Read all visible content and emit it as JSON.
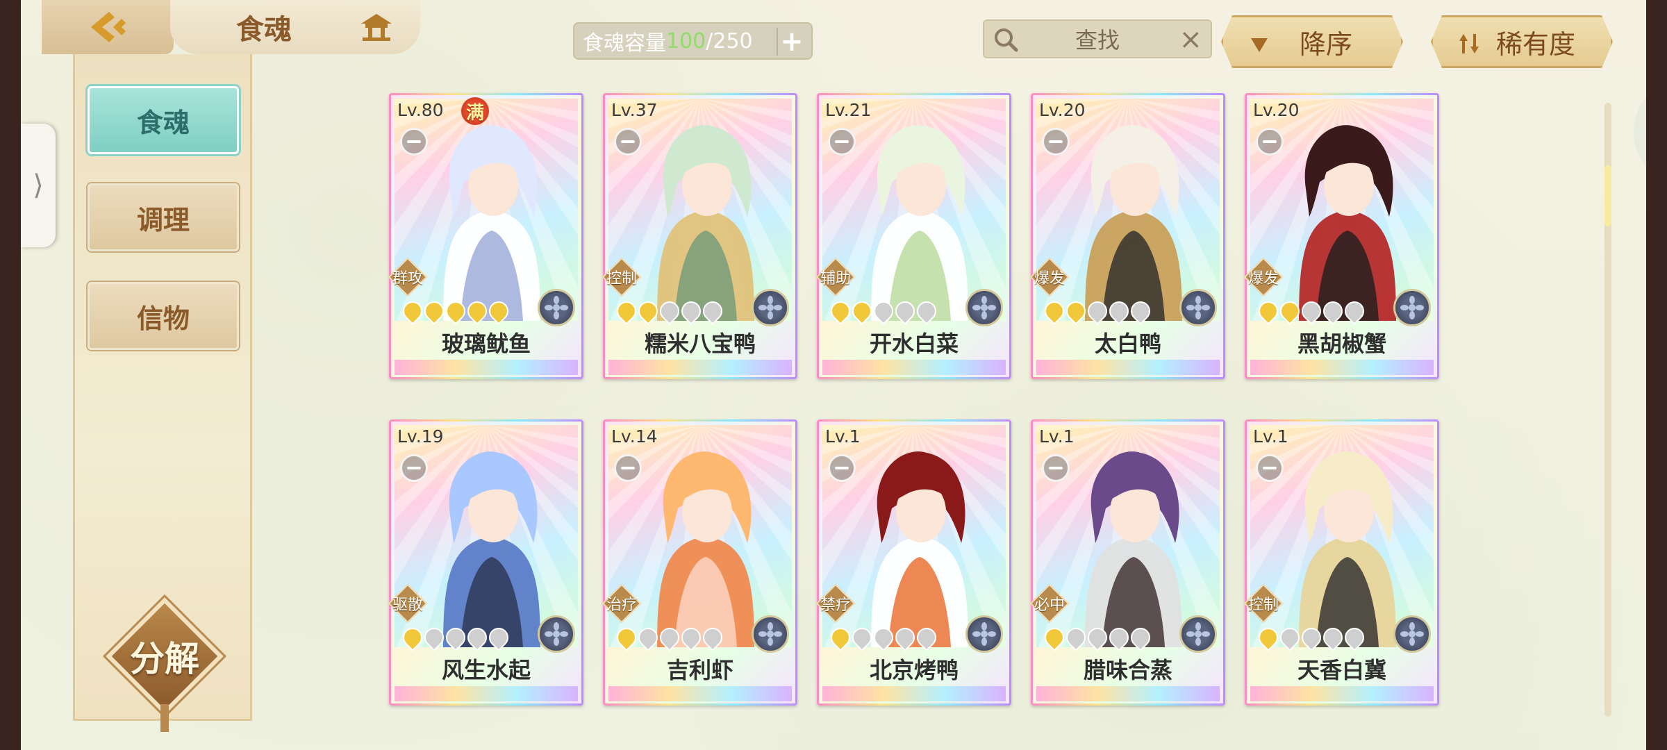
{
  "header": {
    "title": "食魂",
    "capacity_label": "食魂容量 ",
    "capacity_used": "100",
    "capacity_total": "/250",
    "add_label": "+",
    "search_label": "查找",
    "search_clear": "×",
    "sort_order_label": "降序",
    "sort_rarity_label": "稀有度"
  },
  "sidebar": {
    "items": [
      {
        "label": "食魂",
        "active": true
      },
      {
        "label": "调理",
        "active": false
      },
      {
        "label": "信物",
        "active": false
      }
    ],
    "decompose_label": "分解"
  },
  "pull_tab": "⟩",
  "cards": [
    {
      "level": "Lv.80",
      "full": "满",
      "role": "群攻",
      "stars": 5,
      "name": "玻璃鱿鱼",
      "palette": [
        "#dfe8ff",
        "#9aa8d8",
        "#ffffff"
      ]
    },
    {
      "level": "Lv.37",
      "role": "控制",
      "stars": 2,
      "name": "糯米八宝鸭",
      "palette": [
        "#cfe8d0",
        "#6f9a7a",
        "#e0c27a"
      ]
    },
    {
      "level": "Lv.21",
      "role": "辅助",
      "stars": 2,
      "name": "开水白菜",
      "palette": [
        "#eaf5e0",
        "#b5d99a",
        "#ffffff"
      ]
    },
    {
      "level": "Lv.20",
      "role": "爆发",
      "stars": 2,
      "name": "太白鸭",
      "palette": [
        "#f5f0e6",
        "#2b2b2b",
        "#c9a05a"
      ]
    },
    {
      "level": "Lv.20",
      "role": "爆发",
      "stars": 2,
      "name": "黑胡椒蟹",
      "palette": [
        "#3a1a1a",
        "#1e1e1e",
        "#b52a2a"
      ]
    },
    {
      "level": "Lv.19",
      "role": "驱散",
      "stars": 1,
      "name": "风生水起",
      "palette": [
        "#a8c8ff",
        "#2c3550",
        "#5c7cc8"
      ]
    },
    {
      "level": "Lv.14",
      "role": "治疗",
      "stars": 1,
      "name": "吉利虾",
      "palette": [
        "#ffb870",
        "#ffd8c8",
        "#f08a50"
      ]
    },
    {
      "level": "Lv.1",
      "role": "禁疗",
      "stars": 1,
      "name": "北京烤鸭",
      "palette": [
        "#8a1a1a",
        "#e86a2a",
        "#ffffff"
      ]
    },
    {
      "level": "Lv.1",
      "role": "必中",
      "stars": 1,
      "name": "腊味合蒸",
      "palette": [
        "#6a4a8a",
        "#3a2a2a",
        "#e0e0e0"
      ]
    },
    {
      "level": "Lv.1",
      "role": "控制",
      "stars": 1,
      "name": "天香白冀",
      "palette": [
        "#f6ecc8",
        "#2a2a2a",
        "#e8d49a"
      ]
    }
  ],
  "colors": {
    "accent_gold": "#c9921f",
    "active_tab": "#8cd3c7",
    "capacity_used": "#8fdc6a"
  }
}
